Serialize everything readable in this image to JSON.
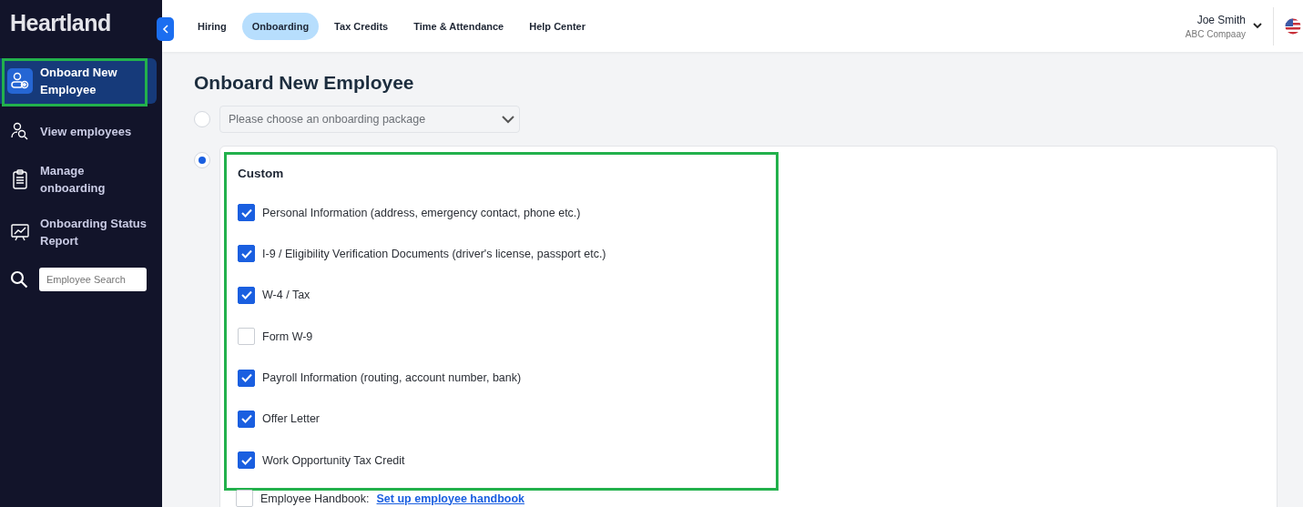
{
  "logo": "Heartland",
  "sidebar": {
    "items": [
      {
        "label": "Onboard New Employee",
        "selected": true
      },
      {
        "label": "View employees",
        "selected": false
      },
      {
        "label": "Manage onboarding",
        "selected": false
      },
      {
        "label": "Onboarding Status Report",
        "selected": false
      }
    ],
    "search": {
      "placeholder": "Employee Search"
    }
  },
  "tabs": [
    {
      "label": "Hiring",
      "selected": false
    },
    {
      "label": "Onboarding",
      "selected": true
    },
    {
      "label": "Tax Credits",
      "selected": false
    },
    {
      "label": "Time & Attendance",
      "selected": false
    },
    {
      "label": "Help Center",
      "selected": false
    }
  ],
  "user": {
    "name": "Joe Smith",
    "company": "ABC Compaay"
  },
  "page_title": "Onboard New Employee",
  "package_option": {
    "selected": false,
    "placeholder": "Please choose an onboarding package"
  },
  "custom_option": {
    "selected": true,
    "title": "Custom",
    "items": [
      {
        "label": "Personal Information (address, emergency contact, phone etc.)",
        "checked": true
      },
      {
        "label": "I-9 / Eligibility Verification Documents (driver's license, passport etc.)",
        "checked": true
      },
      {
        "label": "W-4 / Tax",
        "checked": true
      },
      {
        "label": "Form W-9",
        "checked": false
      },
      {
        "label": "Payroll Information (routing, account number, bank)",
        "checked": true
      },
      {
        "label": "Offer Letter",
        "checked": true
      },
      {
        "label": "Work Opportunity Tax Credit",
        "checked": true
      }
    ],
    "handbook": {
      "checked": false,
      "label": "Employee Handbook:",
      "link": "Set up employee handbook"
    }
  }
}
